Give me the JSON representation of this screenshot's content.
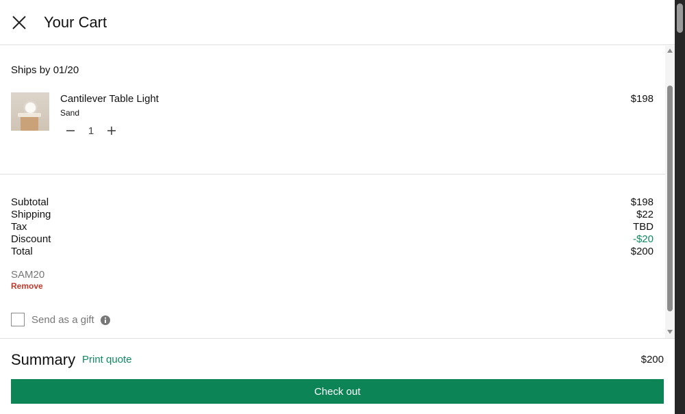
{
  "header": {
    "title": "Your Cart",
    "close_icon": "close-icon"
  },
  "cart": {
    "ships_by": "Ships by 01/20",
    "items": [
      {
        "name": "Cantilever Table Light",
        "variant": "Sand",
        "quantity": "1",
        "price": "$198"
      }
    ]
  },
  "totals": {
    "rows": [
      {
        "label": "Subtotal",
        "value": "$198"
      },
      {
        "label": "Shipping",
        "value": "$22"
      },
      {
        "label": "Tax",
        "value": "TBD"
      },
      {
        "label": "Discount",
        "value": "-$20"
      },
      {
        "label": "Total",
        "value": "$200"
      }
    ]
  },
  "promo": {
    "code": "SAM20",
    "remove_label": "Remove"
  },
  "gift": {
    "label": "Send as a gift",
    "checked": false
  },
  "summary": {
    "title": "Summary",
    "print_quote": "Print quote",
    "total": "$200",
    "checkout_label": "Check out"
  },
  "colors": {
    "accent": "#0c8456",
    "discount": "#0f8a5f",
    "remove": "#c0392b"
  }
}
